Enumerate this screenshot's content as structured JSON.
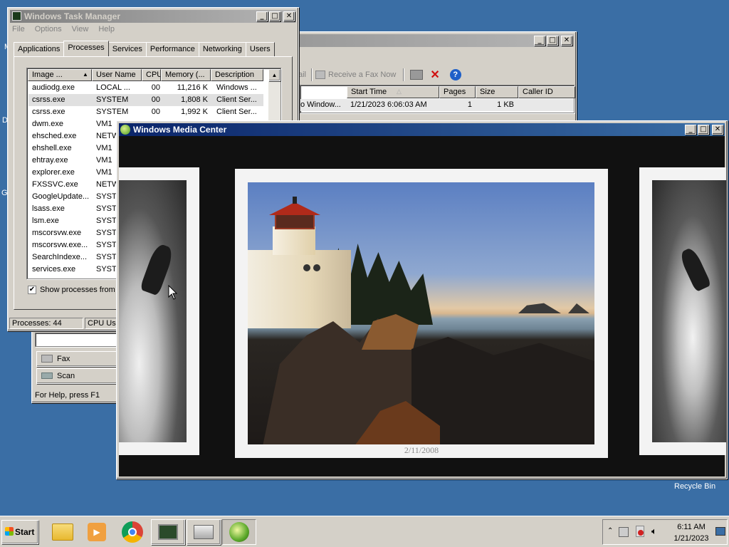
{
  "desktop": {
    "recycle_bin_label": "Recycle Bin",
    "edge_letters": [
      "M",
      "D",
      "G"
    ]
  },
  "task_manager": {
    "title": "Windows Task Manager",
    "menu": [
      "File",
      "Options",
      "View",
      "Help"
    ],
    "tabs": [
      "Applications",
      "Processes",
      "Services",
      "Performance",
      "Networking",
      "Users"
    ],
    "active_tab": "Processes",
    "columns": [
      "Image ...",
      "User Name",
      "CPU",
      "Memory (...",
      "Description"
    ],
    "rows": [
      {
        "image": "audiodg.exe",
        "user": "LOCAL ...",
        "cpu": "00",
        "memory": "11,216 K",
        "desc": "Windows ..."
      },
      {
        "image": "csrss.exe",
        "user": "SYSTEM",
        "cpu": "00",
        "memory": "1,808 K",
        "desc": "Client Ser..."
      },
      {
        "image": "csrss.exe",
        "user": "SYSTEM",
        "cpu": "00",
        "memory": "1,992 K",
        "desc": "Client Ser..."
      },
      {
        "image": "dwm.exe",
        "user": "VM1",
        "cpu": "",
        "memory": "",
        "desc": ""
      },
      {
        "image": "ehsched.exe",
        "user": "NETW",
        "cpu": "",
        "memory": "",
        "desc": ""
      },
      {
        "image": "ehshell.exe",
        "user": "VM1",
        "cpu": "",
        "memory": "",
        "desc": ""
      },
      {
        "image": "ehtray.exe",
        "user": "VM1",
        "cpu": "",
        "memory": "",
        "desc": ""
      },
      {
        "image": "explorer.exe",
        "user": "VM1",
        "cpu": "",
        "memory": "",
        "desc": ""
      },
      {
        "image": "FXSSVC.exe",
        "user": "NETW",
        "cpu": "",
        "memory": "",
        "desc": ""
      },
      {
        "image": "GoogleUpdate...",
        "user": "SYSTE",
        "cpu": "",
        "memory": "",
        "desc": ""
      },
      {
        "image": "lsass.exe",
        "user": "SYSTE",
        "cpu": "",
        "memory": "",
        "desc": ""
      },
      {
        "image": "lsm.exe",
        "user": "SYSTE",
        "cpu": "",
        "memory": "",
        "desc": ""
      },
      {
        "image": "mscorsvw.exe",
        "user": "SYSTE",
        "cpu": "",
        "memory": "",
        "desc": ""
      },
      {
        "image": "mscorsvw.exe...",
        "user": "SYSTE",
        "cpu": "",
        "memory": "",
        "desc": ""
      },
      {
        "image": "SearchIndexe...",
        "user": "SYSTE",
        "cpu": "",
        "memory": "",
        "desc": ""
      },
      {
        "image": "services.exe",
        "user": "SYSTE",
        "cpu": "",
        "memory": "",
        "desc": ""
      }
    ],
    "show_all_label": "Show processes from a",
    "status_processes": "Processes: 44",
    "status_cpu": "CPU Usa"
  },
  "fax_window": {
    "toolbar_partial": "ail",
    "receive_label": "Receive a Fax Now",
    "columns": [
      "Start Time",
      "Pages",
      "Size",
      "Caller ID"
    ],
    "row": {
      "name": "o Window...",
      "start": "1/21/2023 6:06:03 AM",
      "pages": "1",
      "size": "1 KB"
    },
    "side_buttons": [
      "Fax",
      "Scan"
    ],
    "status": "For Help, press F1"
  },
  "media_center": {
    "title": "Windows Media Center",
    "photo_date": "2/11/2008"
  },
  "taskbar": {
    "start_label": "Start",
    "time": "6:11 AM",
    "date": "1/21/2023"
  }
}
